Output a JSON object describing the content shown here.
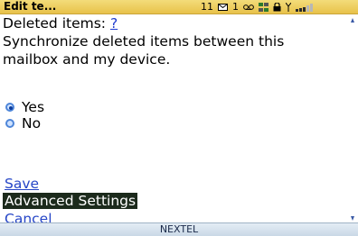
{
  "statusbar": {
    "title": "Edit te...",
    "mail_count": "11",
    "mail_icon": "envelope-icon",
    "voicemail_count": "1",
    "voicemail_icon": "voicemail-icon",
    "network_icon": "network-icon",
    "lock_icon": "lock-icon",
    "signal_icon": "signal-strength-icon",
    "signal_level_bars": 3,
    "signal_max_bars": 5
  },
  "content": {
    "heading": "Deleted items:",
    "help_link": "?",
    "description_line1": "Synchronize deleted items between this",
    "description_line2": "mailbox and my device."
  },
  "options": {
    "selected": "Yes",
    "items": [
      {
        "label": "Yes"
      },
      {
        "label": "No"
      }
    ]
  },
  "actions": {
    "save": "Save",
    "advanced": "Advanced Settings",
    "cancel": "Cancel",
    "focused": "Advanced Settings"
  },
  "carrier": "NEXTEL",
  "colors": {
    "statusbar": "#e8c24a",
    "link": "#2646c7",
    "focus_bg": "#1c2a1c",
    "radio": "#4e86d9"
  }
}
